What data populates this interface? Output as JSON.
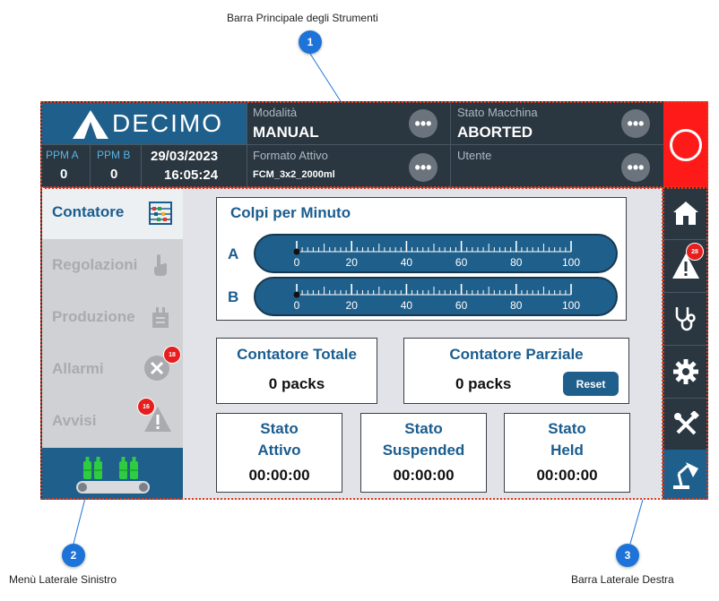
{
  "callouts": [
    {
      "number": "1",
      "label": "Barra Principale degli Strumenti"
    },
    {
      "number": "2",
      "label": "Menù Laterale Sinistro"
    },
    {
      "number": "3",
      "label": "Barra Laterale Destra"
    }
  ],
  "header": {
    "logo_text": "DECIMO",
    "modalita": {
      "label": "Modalità",
      "value": "MANUAL"
    },
    "stato_macchina": {
      "label": "Stato Macchina",
      "value": "ABORTED"
    },
    "formato_attivo": {
      "label": "Formato Attivo",
      "value": "FCM_3x2_2000ml"
    },
    "utente": {
      "label": "Utente",
      "value": ""
    },
    "ppm_a": {
      "label": "PPM A",
      "value": "0"
    },
    "ppm_b": {
      "label": "PPM B",
      "value": "0"
    },
    "date": "29/03/2023",
    "time": "16:05:24",
    "more_symbol": "•••",
    "stop_button_icon": "stop-circle-icon"
  },
  "left_menu": {
    "items": [
      {
        "label": "Contatore",
        "icon": "abacus-icon",
        "active": true
      },
      {
        "label": "Regolazioni",
        "icon": "hand-pointer-icon",
        "active": false
      },
      {
        "label": "Produzione",
        "icon": "machine-icon",
        "active": false
      },
      {
        "label": "Allarmi",
        "icon": "error-x-icon",
        "active": false,
        "badge": "18"
      },
      {
        "label": "Avvisi",
        "icon": "warning-icon",
        "active": false,
        "badge": "16"
      }
    ],
    "bottom_icon": "conveyor-bottles-icon"
  },
  "main": {
    "cpm": {
      "title": "Colpi per Minuto",
      "gauges": [
        {
          "label": "A",
          "value": 0
        },
        {
          "label": "B",
          "value": 0
        }
      ],
      "scale": {
        "min": 0,
        "max": 100,
        "ticks": [
          "0",
          "20",
          "40",
          "60",
          "80",
          "100"
        ]
      }
    },
    "contatore_totale": {
      "title": "Contatore Totale",
      "value": "0 packs"
    },
    "contatore_parziale": {
      "title": "Contatore Parziale",
      "value": "0 packs",
      "reset_label": "Reset"
    },
    "states": [
      {
        "line1": "Stato",
        "line2": "Attivo",
        "time": "00:00:00"
      },
      {
        "line1": "Stato",
        "line2": "Suspended",
        "time": "00:00:00"
      },
      {
        "line1": "Stato",
        "line2": "Held",
        "time": "00:00:00"
      }
    ]
  },
  "right_bar": {
    "items": [
      {
        "icon": "home-icon"
      },
      {
        "icon": "warning-icon",
        "badge": "28"
      },
      {
        "icon": "stethoscope-icon"
      },
      {
        "icon": "gear-icon"
      },
      {
        "icon": "tools-icon"
      },
      {
        "icon": "lamp-icon",
        "active": true
      }
    ]
  },
  "colors": {
    "accent_blue": "#1f5f8b",
    "header_dark": "#2a3640",
    "stop_red": "#ff1a1a",
    "callout_blue": "#1e73d8",
    "badge_red": "#e61e1e"
  }
}
